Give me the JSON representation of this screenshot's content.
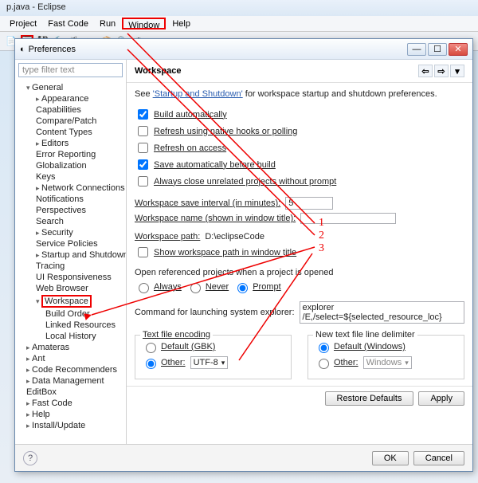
{
  "mainTitle": "p.java - Eclipse",
  "menu": {
    "project": "Project",
    "fastcode": "Fast Code",
    "run": "Run",
    "window": "Window",
    "help": "Help"
  },
  "dialog": {
    "title": "Preferences",
    "filterPlaceholder": "type filter text"
  },
  "tree": {
    "general": "General",
    "items": [
      "Appearance",
      "Capabilities",
      "Compare/Patch",
      "Content Types",
      "Editors",
      "Error Reporting",
      "Globalization",
      "Keys",
      "Network Connections",
      "Notifications",
      "Perspectives",
      "Search",
      "Security",
      "Service Policies",
      "Startup and Shutdown",
      "Tracing",
      "UI Responsiveness",
      "Web Browser",
      "Workspace",
      "Build Order",
      "Linked Resources",
      "Local History"
    ],
    "top": [
      "Amateras",
      "Ant",
      "Code Recommenders",
      "Data Management",
      "EditBox",
      "Fast Code",
      "Help",
      "Install/Update"
    ]
  },
  "page": {
    "title": "Workspace",
    "seeText": "See ",
    "linkStartup": "'Startup and Shutdown'",
    "seeSuffix": " for workspace startup and shutdown preferences.",
    "opts": {
      "build": "Build automatically",
      "refreshHooks": "Refresh using native hooks or polling",
      "refreshAccess": "Refresh on access",
      "saveAuto": "Save automatically before build",
      "closeUnrel": "Always close unrelated projects without prompt"
    },
    "checked": {
      "build": true,
      "refreshHooks": false,
      "refreshAccess": false,
      "saveAuto": true,
      "closeUnrel": false
    },
    "intervalLabel": "Workspace save interval (in minutes):",
    "intervalValue": "5",
    "wsNameLabel": "Workspace name (shown in window title):",
    "wsNameValue": "",
    "wsPathLabel": "Workspace path:",
    "wsPathValue": "D:\\eclipseCode",
    "showPath": "Show workspace path in window title",
    "openRef": "Open referenced projects when a project is opened",
    "always": "Always",
    "never": "Never",
    "prompt": "Prompt",
    "cmdLabel": "Command for launching system explorer:",
    "cmdValue": "explorer /E,/select=${selected_resource_loc}",
    "encGroup": "Text file encoding",
    "encDefault": "Default (GBK)",
    "encOther": "Other:",
    "encOtherVal": "UTF-8",
    "delimGroup": "New text file line delimiter",
    "delimDefault": "Default (Windows)",
    "delimOther": "Other:",
    "delimOtherVal": "Windows",
    "restore": "Restore Defaults",
    "apply": "Apply",
    "ok": "OK",
    "cancel": "Cancel"
  },
  "nums": {
    "one": "1",
    "two": "2",
    "three": "3"
  },
  "icons": {
    "back": "⇦",
    "fwd": "⇨",
    "menu": "▾",
    "min": "—",
    "max": "☐",
    "close": "✕",
    "help": "?"
  }
}
